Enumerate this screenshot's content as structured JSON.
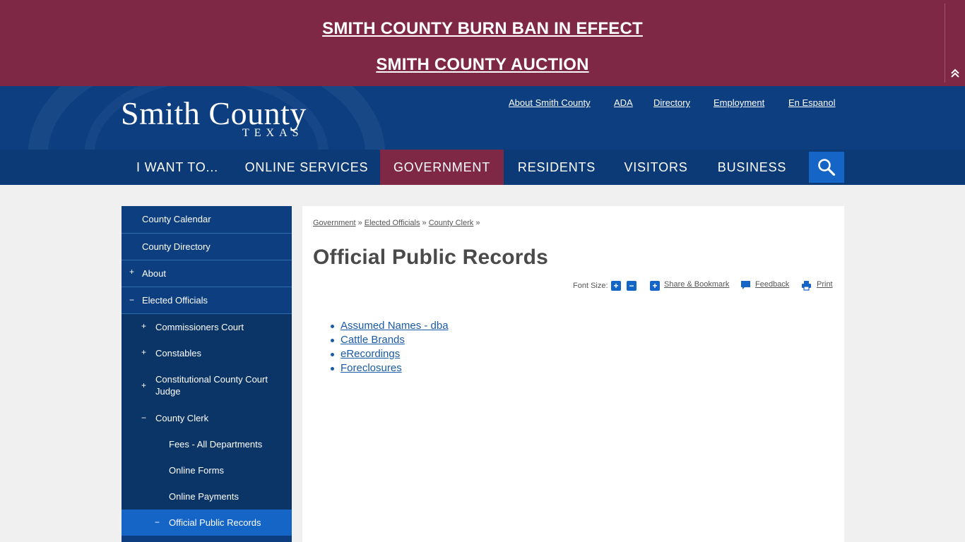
{
  "alert": {
    "links": [
      "SMITH COUNTY BURN BAN IN EFFECT",
      "SMITH COUNTY AUCTION"
    ],
    "toggle_icon": "double-chevron-up-icon"
  },
  "header": {
    "logo_title": "Smith County",
    "logo_subtitle": "TEXAS",
    "utility_links": [
      "About Smith County",
      "ADA",
      "Directory",
      "Employment",
      "En Espanol"
    ]
  },
  "nav": {
    "items": [
      "I WANT TO...",
      "ONLINE SERVICES",
      "GOVERNMENT",
      "RESIDENTS",
      "VISITORS",
      "BUSINESS"
    ],
    "active": "GOVERNMENT",
    "search_icon": "search-icon"
  },
  "sidebar": {
    "items": [
      {
        "label": "County Calendar",
        "sign": ""
      },
      {
        "label": "County Directory",
        "sign": ""
      },
      {
        "label": "About",
        "sign": "+"
      },
      {
        "label": "Elected Officials",
        "sign": "−"
      },
      {
        "label": "Commissioners Court",
        "sign": "+"
      },
      {
        "label": "Constables",
        "sign": "+"
      },
      {
        "label": "Constitutional County Court Judge",
        "sign": "+"
      },
      {
        "label": "County Clerk",
        "sign": "−"
      },
      {
        "label": "Fees - All Departments",
        "sign": ""
      },
      {
        "label": "Online Forms",
        "sign": ""
      },
      {
        "label": "Online Payments",
        "sign": ""
      },
      {
        "label": "Official Public Records",
        "sign": "−"
      }
    ]
  },
  "content": {
    "breadcrumb": [
      "Government",
      "Elected Officials",
      "County Clerk"
    ],
    "breadcrumb_sep": "»",
    "title": "Official Public Records",
    "tools": {
      "font_size_label": "Font Size:",
      "share": "Share & Bookmark",
      "feedback": "Feedback",
      "print": "Print"
    },
    "records": [
      "Assumed Names - dba ",
      "Cattle Brands",
      "eRecordings",
      "Foreclosures"
    ]
  },
  "colors": {
    "alert_bg": "#7f2846",
    "header_bg": "#0d3f80",
    "accent": "#1465c6",
    "active_nav": "#7f2846"
  }
}
